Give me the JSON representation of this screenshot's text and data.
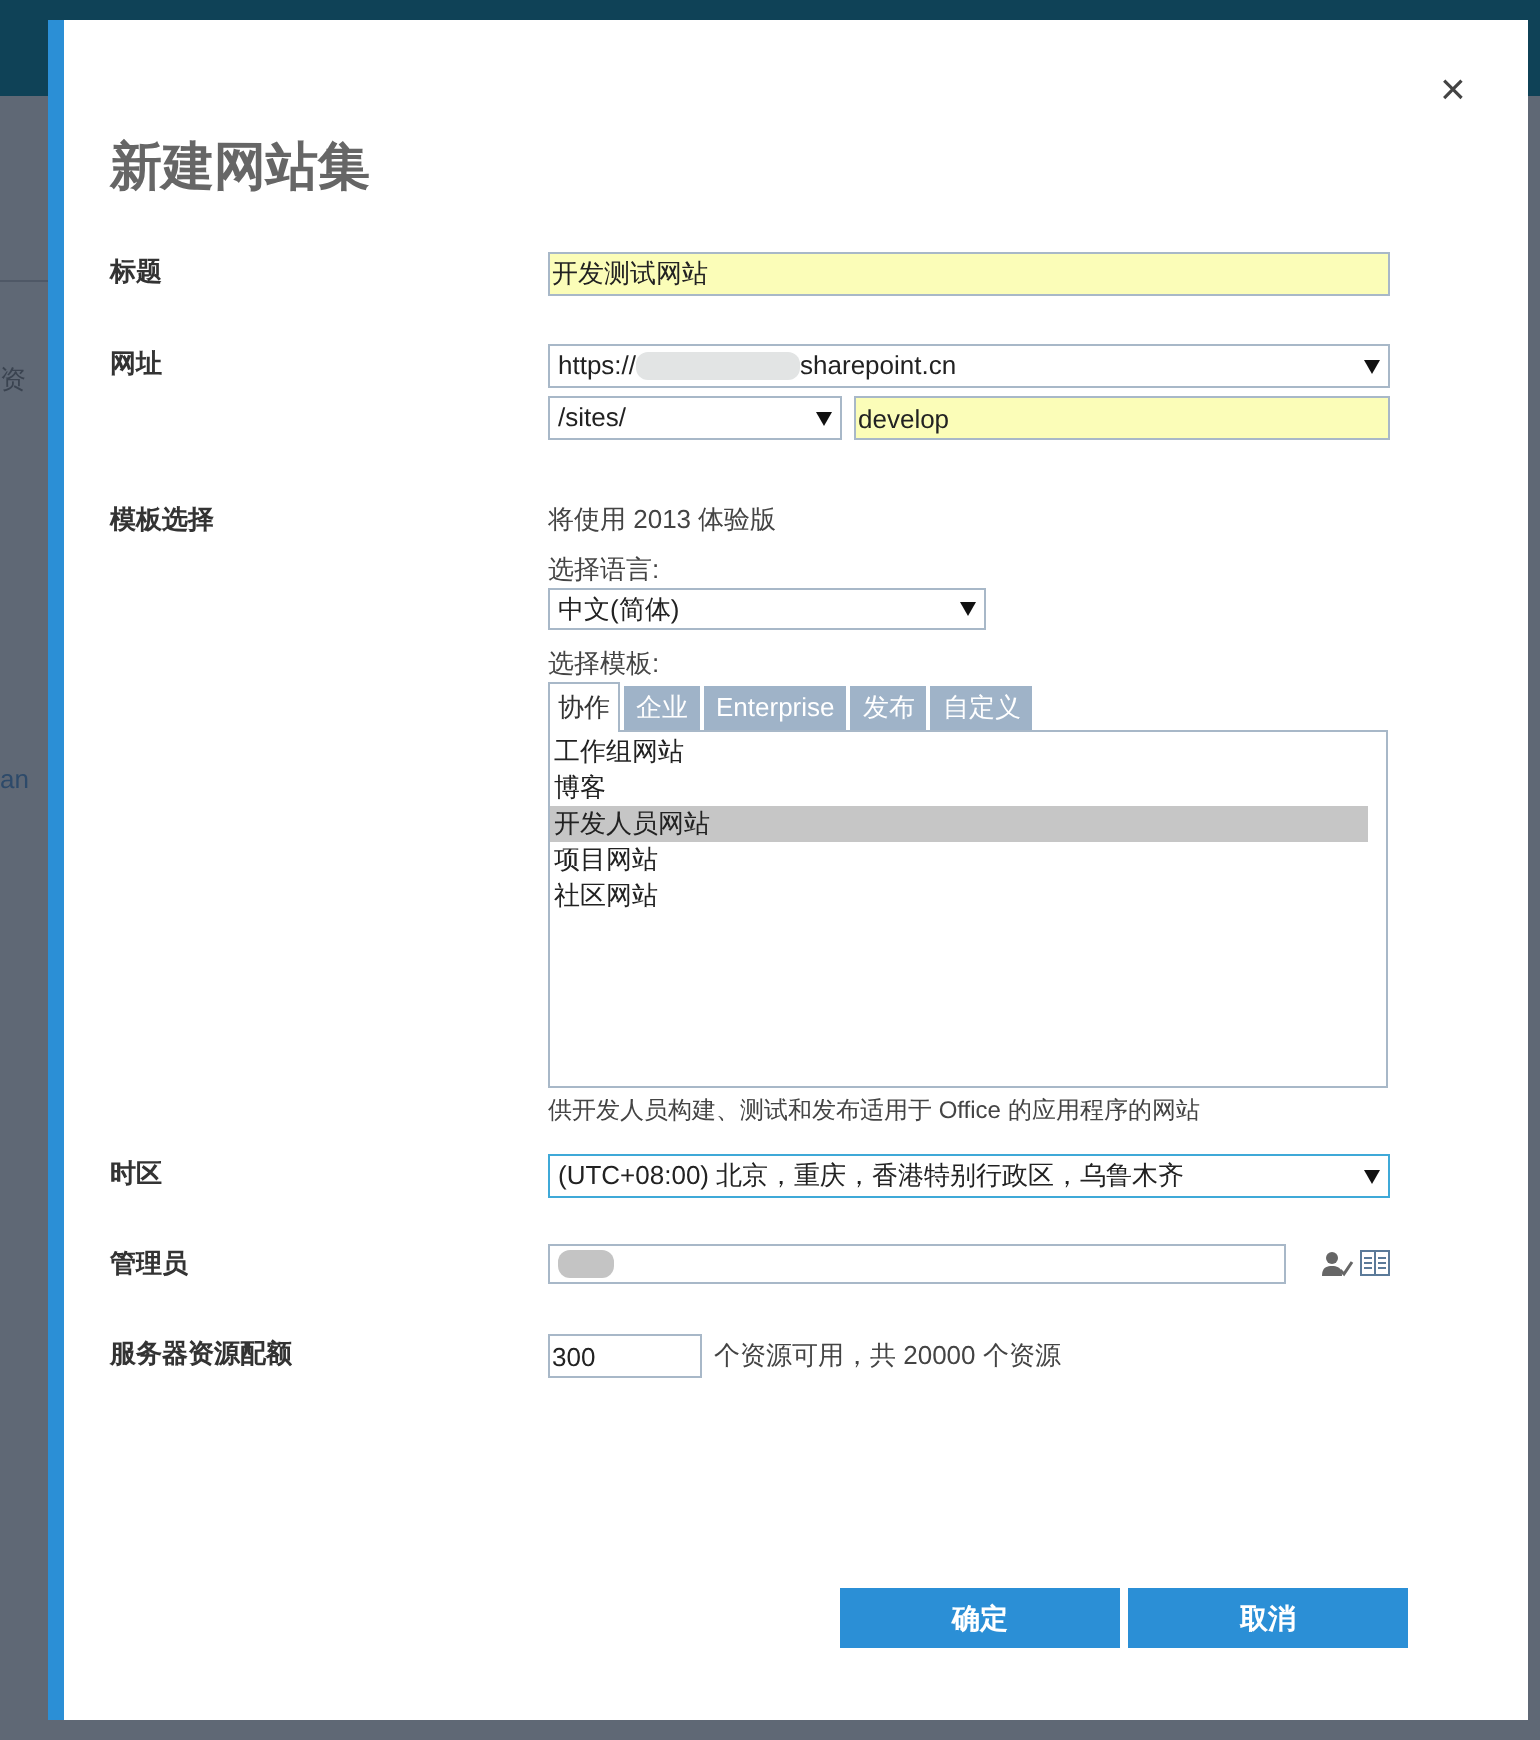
{
  "background": {
    "fragments": [
      "资",
      "an"
    ]
  },
  "dialog": {
    "title": "新建网站集",
    "close": "×"
  },
  "title_field": {
    "label": "标题",
    "value": "开发测试网站"
  },
  "url": {
    "label": "网址",
    "prefix": "https://",
    "suffix": "sharepoint.cn",
    "path": "/sites/",
    "name": "develop"
  },
  "template": {
    "label": "模板选择",
    "note": "将使用 2013 体验版",
    "language_label": "选择语言:",
    "language": "中文(简体)",
    "template_label": "选择模板:",
    "tabs": [
      {
        "label": "协作",
        "selected": true
      },
      {
        "label": "企业",
        "selected": false
      },
      {
        "label": "Enterprise",
        "selected": false
      },
      {
        "label": "发布",
        "selected": false
      },
      {
        "label": "自定义",
        "selected": false
      }
    ],
    "items": [
      {
        "label": "工作组网站",
        "selected": false
      },
      {
        "label": "博客",
        "selected": false
      },
      {
        "label": "开发人员网站",
        "selected": true
      },
      {
        "label": "项目网站",
        "selected": false
      },
      {
        "label": "社区网站",
        "selected": false
      }
    ],
    "description": "供开发人员构建、测试和发布适用于 Office 的应用程序的网站"
  },
  "timezone": {
    "label": "时区",
    "value": "(UTC+08:00) 北京，重庆，香港特别行政区，乌鲁木齐",
    "focused": true
  },
  "admin": {
    "label": "管理员"
  },
  "quota": {
    "label": "服务器资源配额",
    "value": "300",
    "note": "个资源可用，共 20000 个资源"
  },
  "buttons": [
    "确定",
    "取消"
  ]
}
